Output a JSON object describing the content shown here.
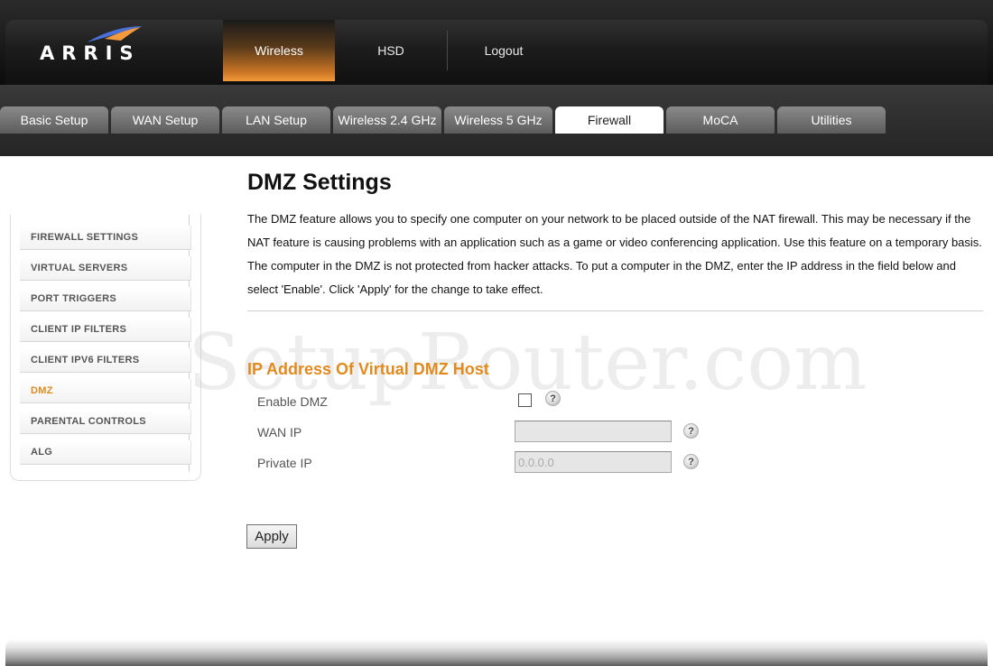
{
  "brand": {
    "logo_text": "ARRIS"
  },
  "top_nav": [
    {
      "label": "Wireless",
      "active": true
    },
    {
      "label": "HSD",
      "active": false
    },
    {
      "label": "Logout",
      "active": false
    }
  ],
  "tabs": [
    {
      "label": "Basic Setup"
    },
    {
      "label": "WAN Setup"
    },
    {
      "label": "LAN Setup"
    },
    {
      "label": "Wireless 2.4 GHz"
    },
    {
      "label": "Wireless 5 GHz"
    },
    {
      "label": "Firewall"
    },
    {
      "label": "MoCA"
    },
    {
      "label": "Utilities"
    }
  ],
  "active_tab": "Firewall",
  "sidebar": {
    "items": [
      {
        "label": "FIREWALL SETTINGS"
      },
      {
        "label": "VIRTUAL SERVERS"
      },
      {
        "label": "PORT TRIGGERS"
      },
      {
        "label": "CLIENT IP FILTERS"
      },
      {
        "label": "CLIENT IPV6 FILTERS"
      },
      {
        "label": "DMZ"
      },
      {
        "label": "PARENTAL CONTROLS"
      },
      {
        "label": "ALG"
      }
    ],
    "active_item": "DMZ"
  },
  "main": {
    "title": "DMZ Settings",
    "description": "The DMZ feature allows you to specify one computer on your network to be placed outside of the NAT firewall. This may be necessary if the NAT feature is causing problems with an application such as a game or video conferencing application. Use this feature on a temporary basis. The computer in the DMZ is not protected from hacker attacks. To put a computer in the DMZ, enter the IP address in the field below and select 'Enable'. Click 'Apply' for the change to take effect.",
    "section_title": "IP Address Of Virtual DMZ Host",
    "form": {
      "enable_label": "Enable DMZ",
      "enable_checked": false,
      "wan_ip_label": "WAN IP",
      "wan_ip_value": "",
      "private_ip_label": "Private IP",
      "private_ip_value": "0.0.0.0",
      "help_glyph": "?"
    },
    "apply_label": "Apply"
  },
  "watermark": "SetupRouter.com",
  "colors": {
    "accent": "#e38a1f",
    "active_nav": "#f39a3c",
    "header_dark": "#1a1a1a"
  },
  "icons": [
    "help-icon",
    "arris-logo-swoosh"
  ]
}
